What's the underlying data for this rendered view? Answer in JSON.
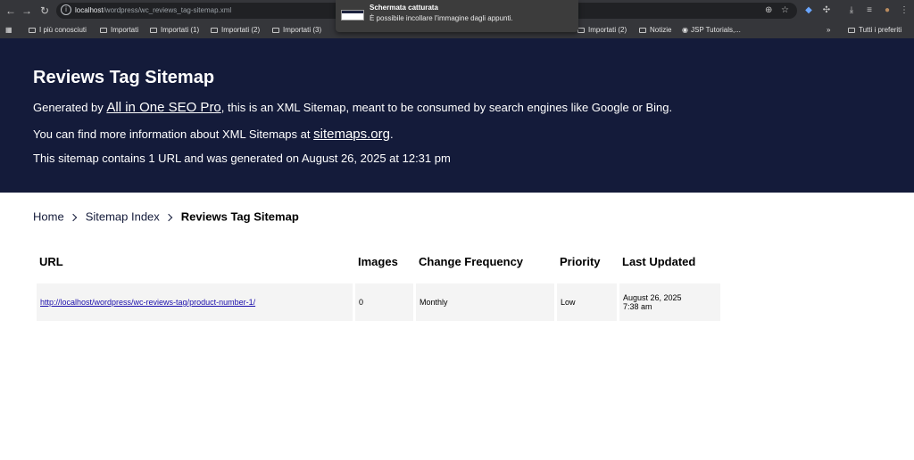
{
  "browser": {
    "url_host": "localhost",
    "url_path": "/wordpress/wc_reviews_tag-sitemap.xml",
    "bookmarks": [
      "I più conosciuti",
      "Importati",
      "Importati (1)",
      "Importati (2)",
      "Importati (3)",
      "Importati (2)",
      "Notizie",
      "JSP Tutorials,..."
    ],
    "overflow_label": "»",
    "all_bookmarks": "Tutti i preferiti"
  },
  "toast": {
    "title": "Schermata catturata",
    "body": "È possibile incollare l'immagine dagli appunti."
  },
  "header": {
    "title": "Reviews Tag Sitemap",
    "line1_prefix": "Generated by ",
    "line1_link": "All in One SEO Pro",
    "line1_suffix": ", this is an XML Sitemap, meant to be consumed by search engines like Google or Bing.",
    "line2_prefix": "You can find more information about XML Sitemaps at ",
    "line2_link": "sitemaps.org",
    "line2_suffix": ".",
    "line3": "This sitemap contains 1 URL and was generated on August 26, 2025 at 12:31 pm"
  },
  "breadcrumb": {
    "home": "Home",
    "index": "Sitemap Index",
    "current": "Reviews Tag Sitemap"
  },
  "table": {
    "headers": {
      "url": "URL",
      "images": "Images",
      "frequency": "Change Frequency",
      "priority": "Priority",
      "updated": "Last Updated"
    },
    "rows": [
      {
        "url": "http://localhost/wordpress/wc-reviews-tag/product-number-1/",
        "images": "0",
        "frequency": "Monthly",
        "priority": "Low",
        "updated_date": "August 26, 2025",
        "updated_time": "7:38 am"
      }
    ]
  }
}
